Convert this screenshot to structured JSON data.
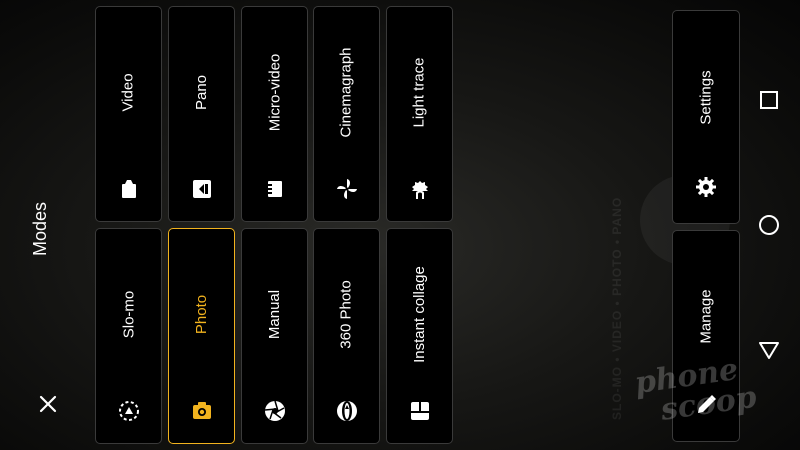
{
  "panel": {
    "title": "Modes",
    "close_icon": "close-icon"
  },
  "modes_top": [
    {
      "label": "Video",
      "icon": "video-icon"
    },
    {
      "label": "Pano",
      "icon": "pano-icon"
    },
    {
      "label": "Micro-video",
      "icon": "micro-video-icon"
    },
    {
      "label": "Cinemagraph",
      "icon": "cinemagraph-icon"
    },
    {
      "label": "Light trace",
      "icon": "light-trace-icon"
    }
  ],
  "modes_bottom": [
    {
      "label": "Slo-mo",
      "icon": "slo-mo-icon"
    },
    {
      "label": "Photo",
      "icon": "camera-icon",
      "selected": true
    },
    {
      "label": "Manual",
      "icon": "aperture-icon"
    },
    {
      "label": "360 Photo",
      "icon": "360-photo-icon"
    },
    {
      "label": "Instant collage",
      "icon": "collage-icon"
    }
  ],
  "actions": {
    "settings": {
      "label": "Settings",
      "icon": "gear-icon"
    },
    "manage": {
      "label": "Manage",
      "icon": "pencil-icon"
    }
  },
  "nav": [
    "recents-button",
    "home-button",
    "back-button"
  ],
  "background": {
    "mode_strip": "SLO-MO • VIDEO • PHOTO • PANO"
  },
  "watermark": {
    "line1": "phone",
    "line2": "scoop"
  },
  "colors": {
    "accent": "#f2b31e",
    "tile_border": "#3a3a3a",
    "text": "#ffffff",
    "background": "#000000"
  }
}
